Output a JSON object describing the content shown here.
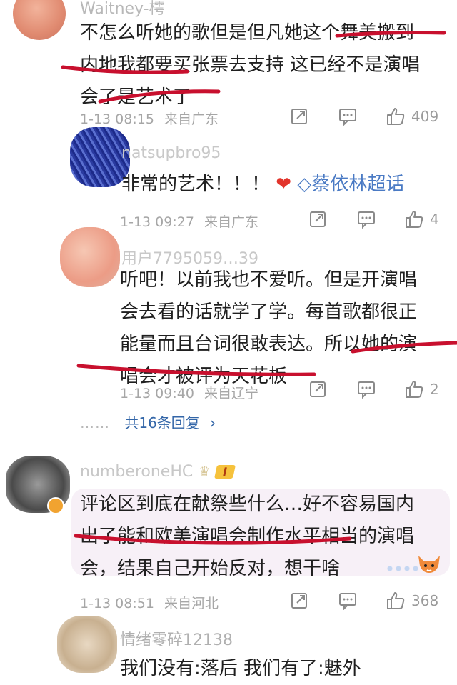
{
  "comments": [
    {
      "username": "Waitney-樗",
      "text_lines": [
        "不怎么听她的歌但是但凡她这个舞美搬到",
        "内地我都要买张票去支持 这已经不是演唱",
        "会了是艺术了"
      ],
      "time": "1-13 08:15",
      "location": "来自广东",
      "likes": "409"
    },
    {
      "username": "natsupbro95",
      "text": "非常的艺术！！！",
      "heart": "❤",
      "topic": "蔡依林超话",
      "time": "1-13 09:27",
      "location": "来自广东",
      "likes": "4"
    },
    {
      "username": "用户7795059…39",
      "text_lines": [
        "听吧！以前我也不爱听。但是开演唱",
        "会去看的话就学了学。每首歌都很正",
        "能量而且台词很敢表达。所以她的演",
        "唱会才被评为天花板"
      ],
      "time": "1-13 09:40",
      "location": "来自辽宁",
      "likes": "2"
    },
    {
      "username": "numberoneHC",
      "badge": "I",
      "text_lines": [
        "评论区到底在献祭些什么…好不容易国内",
        "出了能和欧美演唱会制作水平相当的演唱",
        "会，结果自己开始反对，想干啥"
      ],
      "time": "1-13 08:51",
      "location": "来自河北",
      "likes": "368"
    },
    {
      "username": "情绪零碎12138",
      "text": "我们没有:落后 我们有了:魅外"
    }
  ],
  "replies_link": {
    "dots": "……",
    "label": "共16条回复",
    "arrow": "›"
  },
  "colors": {
    "underline": "#c8102e",
    "link": "#3366a8",
    "meta": "#a6a6a6"
  },
  "icons": [
    "share-icon",
    "comment-icon",
    "like-icon"
  ]
}
